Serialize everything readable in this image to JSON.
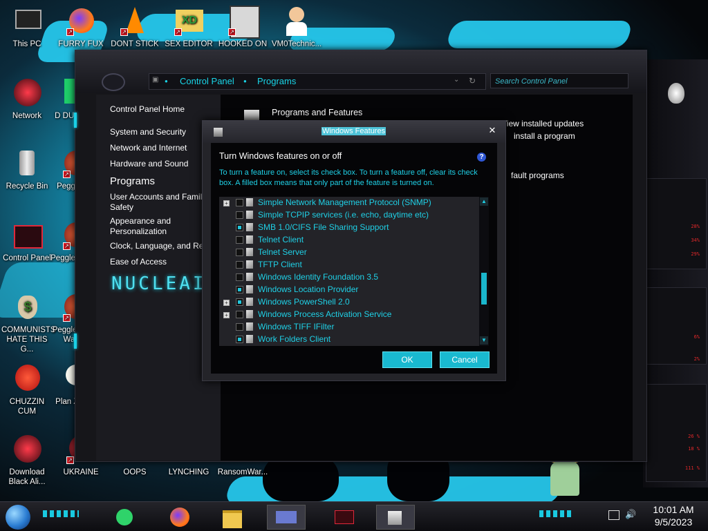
{
  "desktop": {
    "icons": [
      {
        "label": "This PC",
        "icon": "computer-icon"
      },
      {
        "label": "FURRY FUX",
        "icon": "firefox-icon"
      },
      {
        "label": "DONT STICK",
        "icon": "vlc-icon"
      },
      {
        "label": "SEX EDITOR",
        "icon": "xd-editor-icon"
      },
      {
        "label": "HOOKED ON",
        "icon": "maze-app-icon"
      },
      {
        "label": "VM0Technic...",
        "icon": "doctor-icon"
      },
      {
        "label": "Network",
        "icon": "network-alien-icon"
      },
      {
        "label": "D DUM",
        "icon": "green-app-icon"
      },
      {
        "label": "Recycle Bin",
        "icon": "recycle-bin-icon"
      },
      {
        "label": "Peggle",
        "icon": "peggle-icon"
      },
      {
        "label": "Control Panel",
        "icon": "control-panel-icon"
      },
      {
        "label": "Peggle De",
        "icon": "peggle-deluxe-icon"
      },
      {
        "label": "COMMUNISTS HATE THIS G...",
        "icon": "money-bag-icon"
      },
      {
        "label": "Peggle of Wa",
        "icon": "peggle-world-icon"
      },
      {
        "label": "CHUZZIN CUM",
        "icon": "chuzzle-icon"
      },
      {
        "label": "Plan Zo",
        "icon": "plants-zombies-icon"
      },
      {
        "label": "Download Black Ali...",
        "icon": "alien-download-icon"
      },
      {
        "label": "UKRAINE",
        "icon": "ukraine-icon"
      },
      {
        "label": "OOPS",
        "icon": "oops-icon"
      },
      {
        "label": "LYNCHING",
        "icon": "lynching-icon"
      },
      {
        "label": "RansomWar...",
        "icon": "ransomware-icon"
      }
    ]
  },
  "control_panel": {
    "breadcrumb": [
      "Control Panel",
      "Programs"
    ],
    "search_placeholder": "Search Control Panel",
    "left_nav": {
      "home": "Control Panel Home",
      "items": [
        "System and Security",
        "Network and Internet",
        "Hardware and Sound"
      ],
      "current": "Programs",
      "items2": [
        "User Accounts and Family Safety",
        "Appearance and Personalization",
        "Clock, Language, and Region",
        "Ease of Access"
      ]
    },
    "main": {
      "section_title": "Programs and Features",
      "link_updates": "View installed updates",
      "link_install": "install a program",
      "link_defaults": "fault programs"
    },
    "logo_text": "NUCLEAI"
  },
  "dialog": {
    "title": "Windows Features",
    "heading": "Turn Windows features on or off",
    "description": "To turn a feature on, select its check box. To turn a feature off, clear its check box. A filled box means that only part of the feature is turned on.",
    "features": [
      {
        "label": "Simple Network Management Protocol (SNMP)",
        "expandable": true,
        "checked": false
      },
      {
        "label": "Simple TCPIP services (i.e. echo, daytime etc)",
        "expandable": false,
        "checked": false
      },
      {
        "label": "SMB 1.0/CIFS File Sharing Support",
        "expandable": false,
        "checked": true
      },
      {
        "label": "Telnet Client",
        "expandable": false,
        "checked": false
      },
      {
        "label": "Telnet Server",
        "expandable": false,
        "checked": false
      },
      {
        "label": "TFTP Client",
        "expandable": false,
        "checked": false
      },
      {
        "label": "Windows Identity Foundation 3.5",
        "expandable": false,
        "checked": false
      },
      {
        "label": "Windows Location Provider",
        "expandable": false,
        "checked": true
      },
      {
        "label": "Windows PowerShell 2.0",
        "expandable": true,
        "checked": true
      },
      {
        "label": "Windows Process Activation Service",
        "expandable": true,
        "checked": false
      },
      {
        "label": "Windows TIFF IFilter",
        "expandable": false,
        "checked": false
      },
      {
        "label": "Work Folders Client",
        "expandable": false,
        "checked": true
      }
    ],
    "ok_label": "OK",
    "cancel_label": "Cancel"
  },
  "right_widget": {
    "values": [
      "28%",
      "34%",
      "29%",
      "6%",
      "2%",
      "26 %",
      "18 %",
      "111 %"
    ]
  },
  "taskbar": {
    "time": "10:01 AM",
    "date": "9/5/2023",
    "apps": [
      "green-chat-icon",
      "firefox-icon",
      "file-explorer-icon",
      "control-panel-icon",
      "alienware-icon",
      "features-dialog-icon"
    ]
  },
  "colors": {
    "accent": "#1fd0e6",
    "wallpaper": "#26c6ea"
  }
}
